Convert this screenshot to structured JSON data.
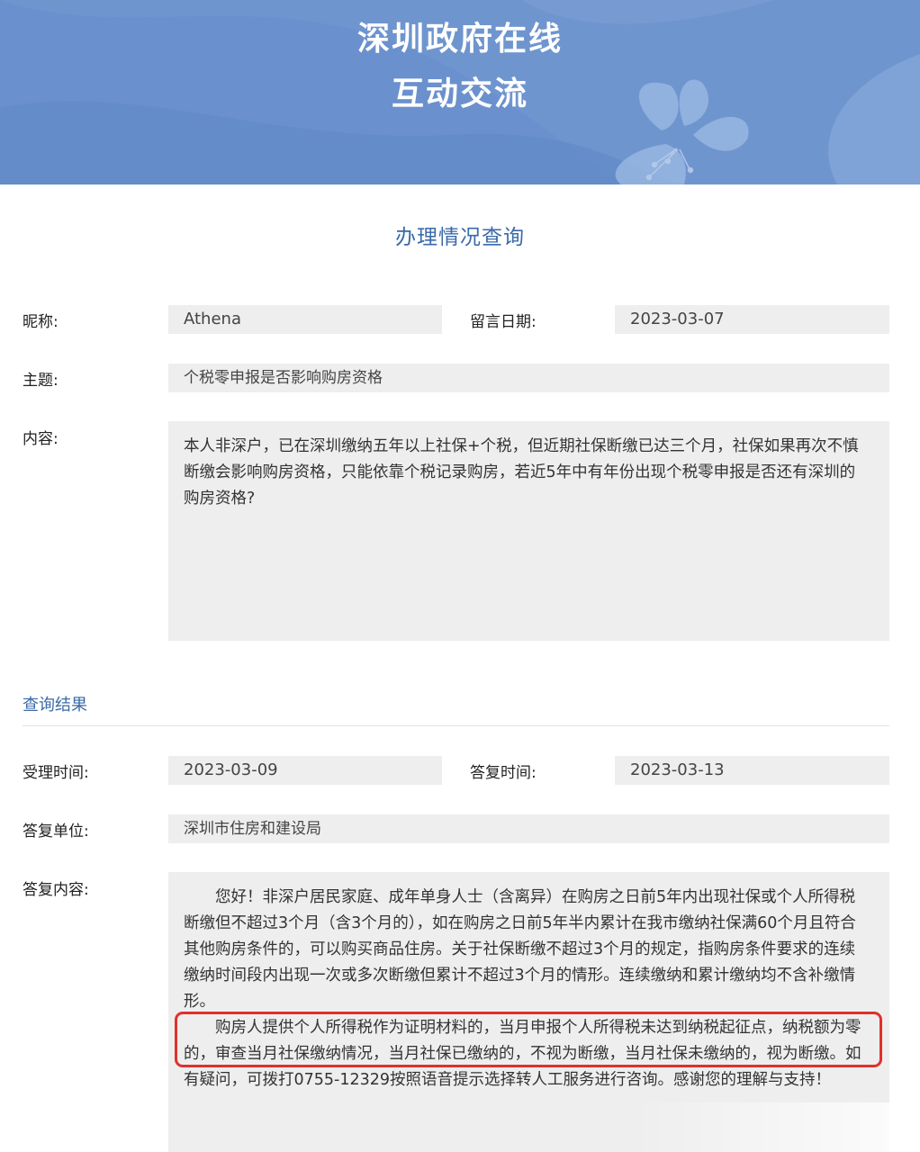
{
  "banner": {
    "line1": "深圳政府在线",
    "line2": "互动交流"
  },
  "page_title": "办理情况查询",
  "inquiry": {
    "nickname_label": "昵称:",
    "nickname": "Athena",
    "date_label": "留言日期:",
    "date": "2023-03-07",
    "subject_label": "主题:",
    "subject": "个税零申报是否影响购房资格",
    "content_label": "内容:",
    "content": "本人非深户，已在深圳缴纳五年以上社保+个税，但近期社保断缴已达三个月，社保如果再次不慎断缴会影响购房资格，只能依靠个税记录购房，若近5年中有年份出现个税零申报是否还有深圳的购房资格?"
  },
  "results": {
    "title": "查询结果",
    "accept_time_label": "受理时间:",
    "accept_time": "2023-03-09",
    "reply_time_label": "答复时间:",
    "reply_time": "2023-03-13",
    "reply_unit_label": "答复单位:",
    "reply_unit": "深圳市住房和建设局",
    "reply_content_label": "答复内容:",
    "reply_para1": "您好！非深户居民家庭、成年单身人士（含离异）在购房之日前5年内出现社保或个人所得税断缴但不超过3个月（含3个月的），如在购房之日前5年半内累计在我市缴纳社保满60个月且符合其他购房条件的，可以购买商品住房。关于社保断缴不超过3个月的规定，指购房条件要求的连续缴纳时间段内出现一次或多次断缴但累计不超过3个月的情形。连续缴纳和累计缴纳均不含补缴情形。",
    "reply_para2": "购房人提供个人所得税作为证明材料的，当月申报个人所得税未达到纳税起征点，纳税额为零的，审查当月社保缴纳情况，当月社保已缴纳的，不视为断缴，当月社保未缴纳的，视为断缴。如有疑问，可拨打0755-12329按照语音提示选择转人工服务进行咨询。感谢您的理解与支持！"
  },
  "colors": {
    "banner_bg": "#6f95cf",
    "accent": "#3b6aa8",
    "field_bg": "#eeeeee",
    "highlight_border": "#e0312c"
  }
}
